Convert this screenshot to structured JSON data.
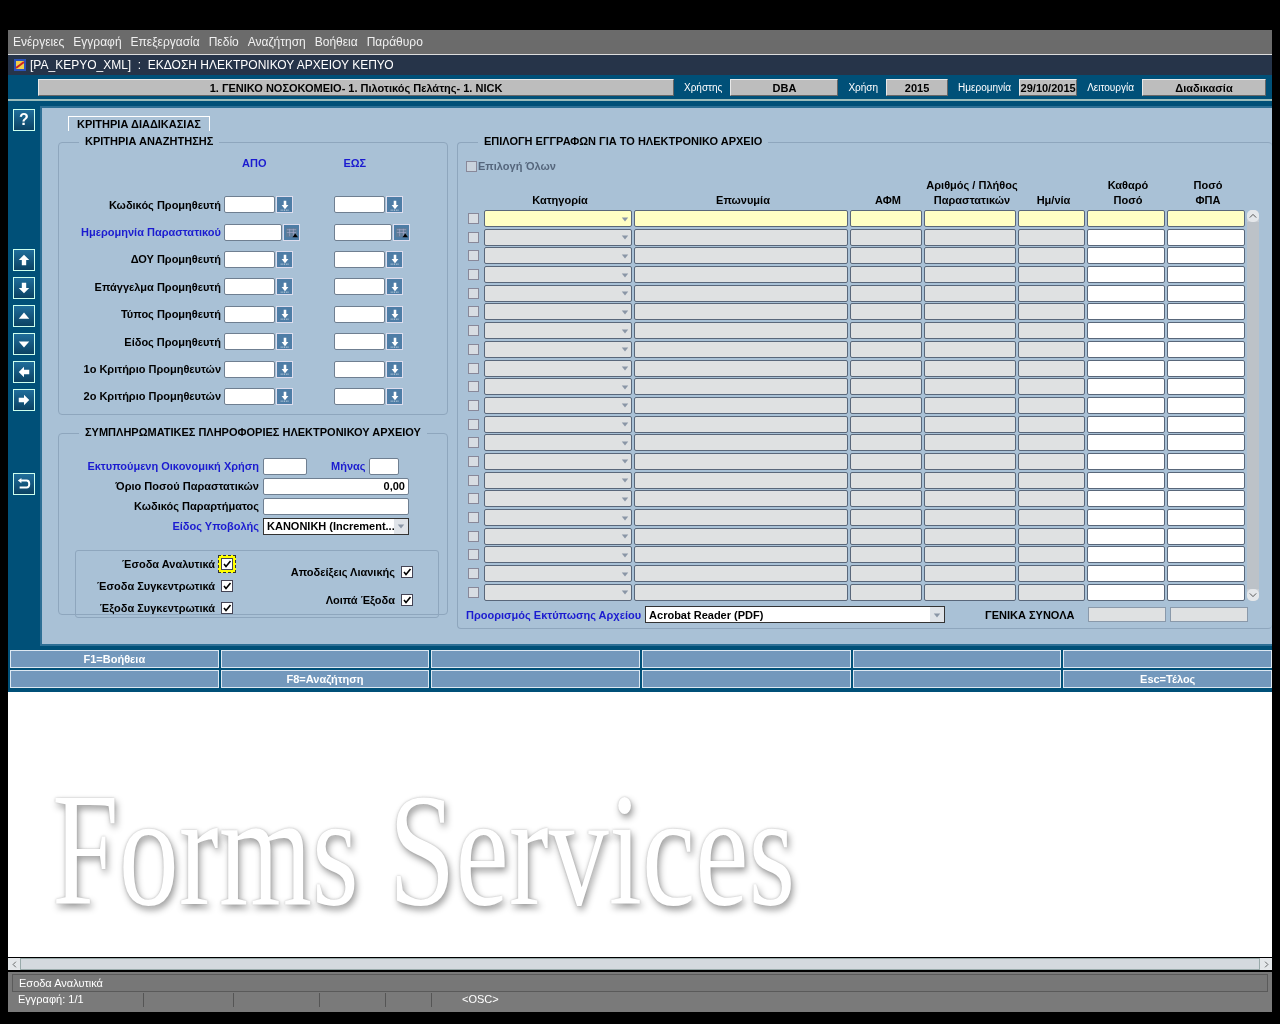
{
  "menu": [
    "Ενέργειες",
    "Εγγραφή",
    "Επεξεργασία",
    "Πεδίο",
    "Αναζήτηση",
    "Βοήθεια",
    "Παράθυρο"
  ],
  "window": {
    "title": "[PA_KEPYO_XML]  :  ΕΚΔΟΣΗ ΗΛΕΚΤΡΟΝΙΚΟΥ ΑΡΧΕΙΟΥ ΚΕΠΥΟ"
  },
  "header": {
    "organization": "1. ΓΕΝΙΚΟ ΝΟΣΟΚΟΜΕΙΟ- 1. Πιλοτικός Πελάτης- 1. NICK",
    "fields": [
      {
        "label": "Χρήστης",
        "value": "DBA"
      },
      {
        "label": "Χρήση",
        "value": "2015"
      },
      {
        "label": "Ημερομηνία",
        "value": "29/10/2015"
      },
      {
        "label": "Λειτουργία",
        "value": "Διαδικασία"
      }
    ]
  },
  "help_button": "?",
  "tab": {
    "label": "ΚΡΙΤΗΡΙΑ ΔΙΑΔΙΚΑΣΙΑΣ"
  },
  "search_criteria": {
    "title": "ΚΡΙΤΗΡΙΑ ΑΝΑΖΗΤΗΣΗΣ",
    "from_label": "ΑΠΟ",
    "to_label": "ΕΩΣ",
    "rows": [
      {
        "label": "Κωδικός Προμηθευτή",
        "kind": "list",
        "required": false
      },
      {
        "label": "Ημερομηνία Παραστατικού",
        "kind": "date",
        "required": true
      },
      {
        "label": "ΔΟΥ Προμηθευτή",
        "kind": "list",
        "required": false
      },
      {
        "label": "Επάγγελμα Προμηθευτή",
        "kind": "list",
        "required": false
      },
      {
        "label": "Τύπος Προμηθευτή",
        "kind": "list",
        "required": false
      },
      {
        "label": "Είδος Προμηθευτή",
        "kind": "list",
        "required": false
      },
      {
        "label": "1ο Κριτήριο Προμηθευτών",
        "kind": "list",
        "required": false
      },
      {
        "label": "2ο Κριτήριο Προμηθευτών",
        "kind": "list",
        "required": false
      }
    ]
  },
  "extra_info": {
    "title": "ΣΥΜΠΛΗΡΩΜΑΤΙΚΕΣ ΠΛΗΡΟΦΟΡΙΕΣ ΗΛΕΚΤΡΟΝΙΚΟΥ ΑΡΧΕΙΟΥ",
    "fiscal_year_label": "Εκτυπούμενη Οικονομική Χρήση",
    "month_label": "Μήνας",
    "amount_limit_label": "Όριο Ποσού Παραστατικών",
    "amount_limit_value": "0,00",
    "branch_code_label": "Κωδικός Παραρτήματος",
    "submission_type_label": "Είδος Υποβολής",
    "submission_type_value": "ΚΑΝΟΝΙΚΗ (Increment...",
    "checks_left": [
      {
        "label": "Έσοδα Αναλυτικά",
        "checked": true,
        "focused": true
      },
      {
        "label": "Έσοδα Συγκεντρωτικά",
        "checked": true,
        "focused": false
      },
      {
        "label": "Έξοδα Συγκεντρωτικά",
        "checked": true,
        "focused": false
      }
    ],
    "checks_right": [
      {
        "label": "Αποδείξεις Λιανικής",
        "checked": true,
        "focused": false
      },
      {
        "label": "Λοιπά Έξοδα",
        "checked": true,
        "focused": false
      }
    ]
  },
  "records": {
    "title": "ΕΠΙΛΟΓΗ ΕΓΓΡΑΦΩΝ ΓΙΑ ΤΟ ΗΛΕΚΤΡΟΝΙΚΟ ΑΡΧΕΙΟ",
    "select_all": {
      "label": "Επιλογή Όλων",
      "checked": false,
      "disabled": true
    },
    "columns": [
      {
        "line2": "Κατηγορία"
      },
      {
        "line2": "Επωνυμία"
      },
      {
        "line2": "ΑΦΜ"
      },
      {
        "line1": "Αριθμός / Πλήθος",
        "line2": "Παραστατικών"
      },
      {
        "line2": "Ημ/νία"
      },
      {
        "line1": "Καθαρό",
        "line2": "Ποσό"
      },
      {
        "line1": "Ποσό",
        "line2": "ΦΠΑ"
      }
    ],
    "rows": [
      {
        "checked": false,
        "current": true
      },
      {
        "checked": false,
        "current": false
      },
      {
        "checked": false,
        "current": false
      },
      {
        "checked": false,
        "current": false
      },
      {
        "checked": false,
        "current": false
      },
      {
        "checked": false,
        "current": false
      },
      {
        "checked": false,
        "current": false
      },
      {
        "checked": false,
        "current": false
      },
      {
        "checked": false,
        "current": false
      },
      {
        "checked": false,
        "current": false
      },
      {
        "checked": false,
        "current": false
      },
      {
        "checked": false,
        "current": false
      },
      {
        "checked": false,
        "current": false
      },
      {
        "checked": false,
        "current": false
      },
      {
        "checked": false,
        "current": false
      },
      {
        "checked": false,
        "current": false
      },
      {
        "checked": false,
        "current": false
      },
      {
        "checked": false,
        "current": false
      },
      {
        "checked": false,
        "current": false
      },
      {
        "checked": false,
        "current": false
      },
      {
        "checked": false,
        "current": false
      }
    ],
    "destination_label": "Προορισμός Εκτύπωσης Αρχείου",
    "destination_value": "Acrobat Reader (PDF)",
    "totals_label": "ΓΕΝΙΚΑ ΣΥΝΟΛΑ"
  },
  "function_keys": [
    [
      {
        "kind": "key",
        "label": "F1=Βοήθεια"
      },
      {
        "kind": "blank"
      },
      {
        "kind": "blank"
      },
      {
        "kind": "blank"
      },
      {
        "kind": "blank"
      },
      {
        "kind": "blank"
      }
    ],
    [
      {
        "kind": "blank"
      },
      {
        "kind": "key",
        "label": "F8=Αναζήτηση"
      },
      {
        "kind": "blank"
      },
      {
        "kind": "blank"
      },
      {
        "kind": "blank"
      },
      {
        "kind": "key",
        "label": "Esc=Τέλος"
      }
    ]
  ],
  "background_logo": "Forms Services",
  "status_bar": {
    "message": "Εσοδα Αναλυτικά",
    "record": "Εγγραφή: 1/1",
    "mode": "<OSC>"
  }
}
